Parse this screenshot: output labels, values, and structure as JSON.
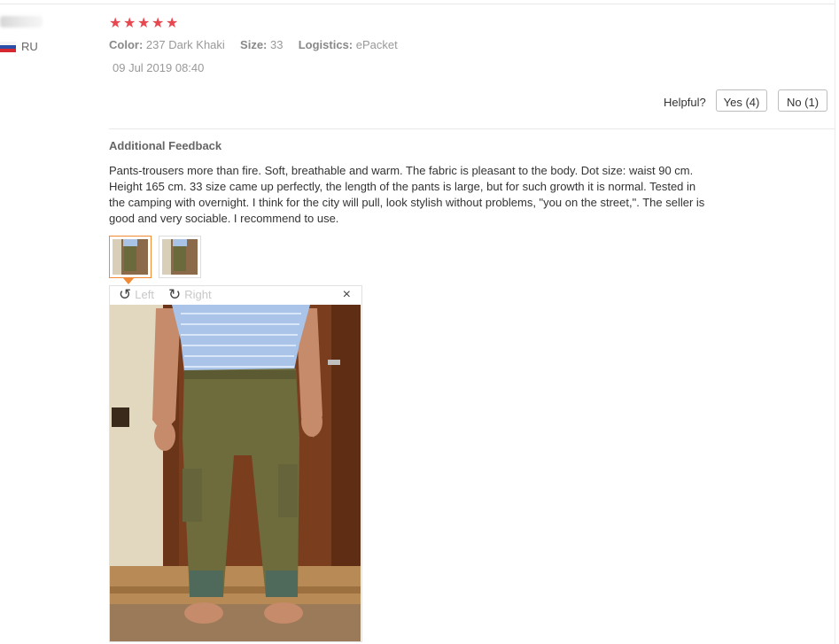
{
  "user": {
    "country": "RU"
  },
  "review": {
    "rating": 5,
    "attributes": [
      {
        "key": "Color:",
        "value": "237 Dark Khaki"
      },
      {
        "key": "Size:",
        "value": "33"
      },
      {
        "key": "Logistics:",
        "value": "ePacket"
      }
    ],
    "date": "09 Jul 2019 08:40",
    "helpful_label": "Helpful?",
    "yes_label": "Yes (4)",
    "no_label": "No (1)"
  },
  "feedback": {
    "title": "Additional Feedback",
    "text": "Pants-trousers more than fire. Soft, breathable and warm. The fabric is pleasant to the body. Dot size: waist 90 cm. Height 165 cm. 33 size came up perfectly, the length of the pants is large, but for such growth it is normal. Tested in the camping with overnight. I think for the city will pull, look stylish without problems, \"you on the street,\". The seller is good and very sociable. I recommend to use."
  },
  "viewer": {
    "rotate_left_label": "Left",
    "rotate_right_label": "Right",
    "close_label": "×",
    "rotate_left_icon": "↺",
    "rotate_right_icon": "↻"
  },
  "icons": {
    "star": "★"
  },
  "colors": {
    "star": "#e8474f",
    "active_thumb_border": "#f28a35"
  }
}
